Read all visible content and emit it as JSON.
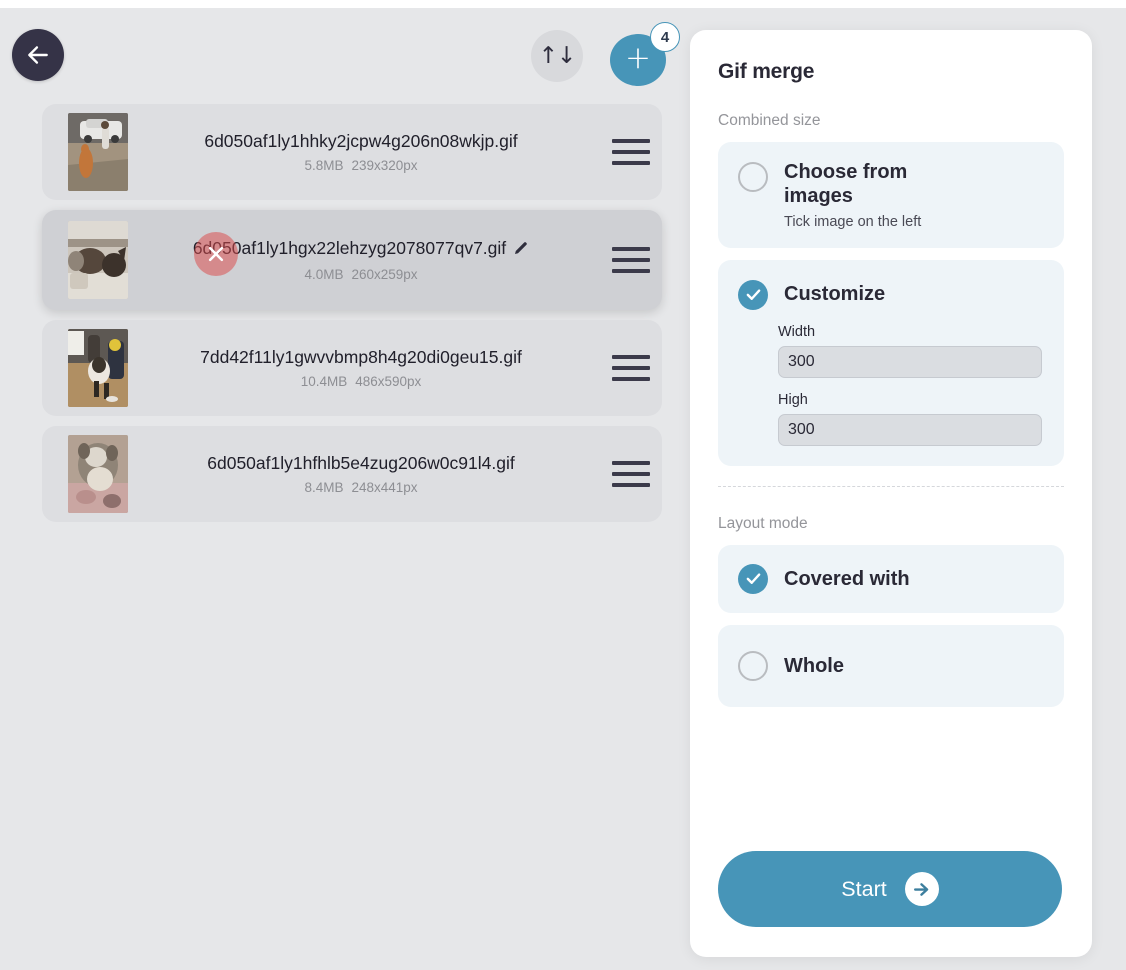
{
  "toolbar": {
    "back_icon": "arrow-left-icon",
    "sort_icon": "sort-updown-icon",
    "sort_glyph": "↑↓",
    "add_icon": "plus-icon",
    "add_badge_count": "4"
  },
  "file_list": {
    "items": [
      {
        "name": "6d050af1ly1hhky2jcpw4g206n08wkjp.gif",
        "size": "5.8MB",
        "dimensions": "239x320px",
        "dragging": false,
        "show_delete": false,
        "show_edit": false,
        "thumb_alt": "dog-and-person-near-white-car"
      },
      {
        "name": "6d050af1ly1hgx22lehzyg2078077qv7.gif",
        "size": "4.0MB",
        "dimensions": "260x259px",
        "dragging": true,
        "show_delete": true,
        "show_edit": true,
        "thumb_alt": "two-dogs-at-food-bowl"
      },
      {
        "name": "7dd42f11ly1gwvvbmp8h4g20di0geu15.gif",
        "size": "10.4MB",
        "dimensions": "486x590px",
        "dragging": false,
        "show_delete": false,
        "show_edit": false,
        "thumb_alt": "dog-with-people-indoors"
      },
      {
        "name": "6d050af1ly1hfhlb5e4zug206w0c91l4.gif",
        "size": "8.4MB",
        "dimensions": "248x441px",
        "dragging": false,
        "show_delete": false,
        "show_edit": false,
        "thumb_alt": "puppy-closeup"
      }
    ]
  },
  "options_panel": {
    "title": "Gif merge",
    "combined_size": {
      "label": "Combined size",
      "choose_from_images": {
        "title": "Choose from images",
        "subtitle": "Tick image on the left",
        "selected": false
      },
      "customize": {
        "title": "Customize",
        "selected": true,
        "width_label": "Width",
        "width_value": "300",
        "height_label": "High",
        "height_value": "300"
      }
    },
    "layout_mode": {
      "label": "Layout mode",
      "options": [
        {
          "title": "Covered with",
          "selected": true
        },
        {
          "title": "Whole",
          "selected": false
        }
      ]
    },
    "start_button": {
      "label": "Start",
      "icon": "arrow-right-icon"
    }
  },
  "colors": {
    "accent": "#4795b8",
    "back_button": "#353347",
    "app_background": "#e6e7e9",
    "row_background": "#dddee1",
    "row_dragging": "#cfd0d4",
    "option_card": "#eef4f8",
    "delete_badge": "#db4a4a",
    "panel": "#ffffff"
  }
}
